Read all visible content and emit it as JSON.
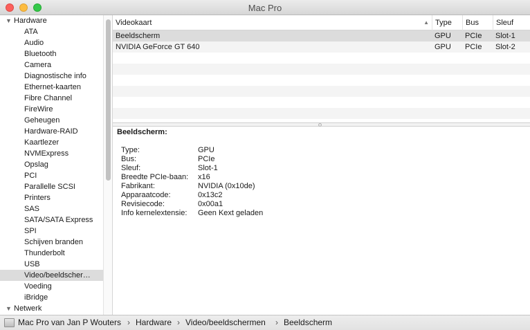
{
  "window": {
    "title": "Mac Pro"
  },
  "sidebar": {
    "groups": [
      {
        "label": "Hardware",
        "expanded": true
      },
      {
        "label": "Netwerk",
        "expanded": true
      }
    ],
    "hardware_items": [
      "ATA",
      "Audio",
      "Bluetooth",
      "Camera",
      "Diagnostische info",
      "Ethernet-kaarten",
      "Fibre Channel",
      "FireWire",
      "Geheugen",
      "Hardware-RAID",
      "Kaartlezer",
      "NVMExpress",
      "Opslag",
      "PCI",
      "Parallelle SCSI",
      "Printers",
      "SAS",
      "SATA/SATA Express",
      "SPI",
      "Schijven branden",
      "Thunderbolt",
      "USB",
      "Video/beeldscher…",
      "Voeding",
      "iBridge"
    ],
    "selected_index": 22
  },
  "table": {
    "columns": [
      "Videokaart",
      "Type",
      "Bus",
      "Sleuf"
    ],
    "rows": [
      {
        "name": "Beeldscherm",
        "type": "GPU",
        "bus": "PCIe",
        "slot": "Slot-1"
      },
      {
        "name": "NVIDIA GeForce GT 640",
        "type": "GPU",
        "bus": "PCIe",
        "slot": "Slot-2"
      }
    ],
    "selected_row": 0
  },
  "detail": {
    "title": "Beeldscherm:",
    "fields": [
      {
        "key": "Type:",
        "value": "GPU"
      },
      {
        "key": "Bus:",
        "value": "PCIe"
      },
      {
        "key": "Sleuf:",
        "value": "Slot-1"
      },
      {
        "key": "Breedte PCIe-baan:",
        "value": "x16"
      },
      {
        "key": "Fabrikant:",
        "value": "NVIDIA (0x10de)"
      },
      {
        "key": "Apparaatcode:",
        "value": "0x13c2"
      },
      {
        "key": "Revisiecode:",
        "value": "0x00a1"
      },
      {
        "key": "Info kernelextensie:",
        "value": "Geen Kext geladen"
      }
    ]
  },
  "pathbar": {
    "crumbs": [
      "Mac Pro van Jan P Wouters",
      "Hardware",
      "Video/beeldschermen",
      "Beeldscherm"
    ],
    "separator": "›"
  }
}
